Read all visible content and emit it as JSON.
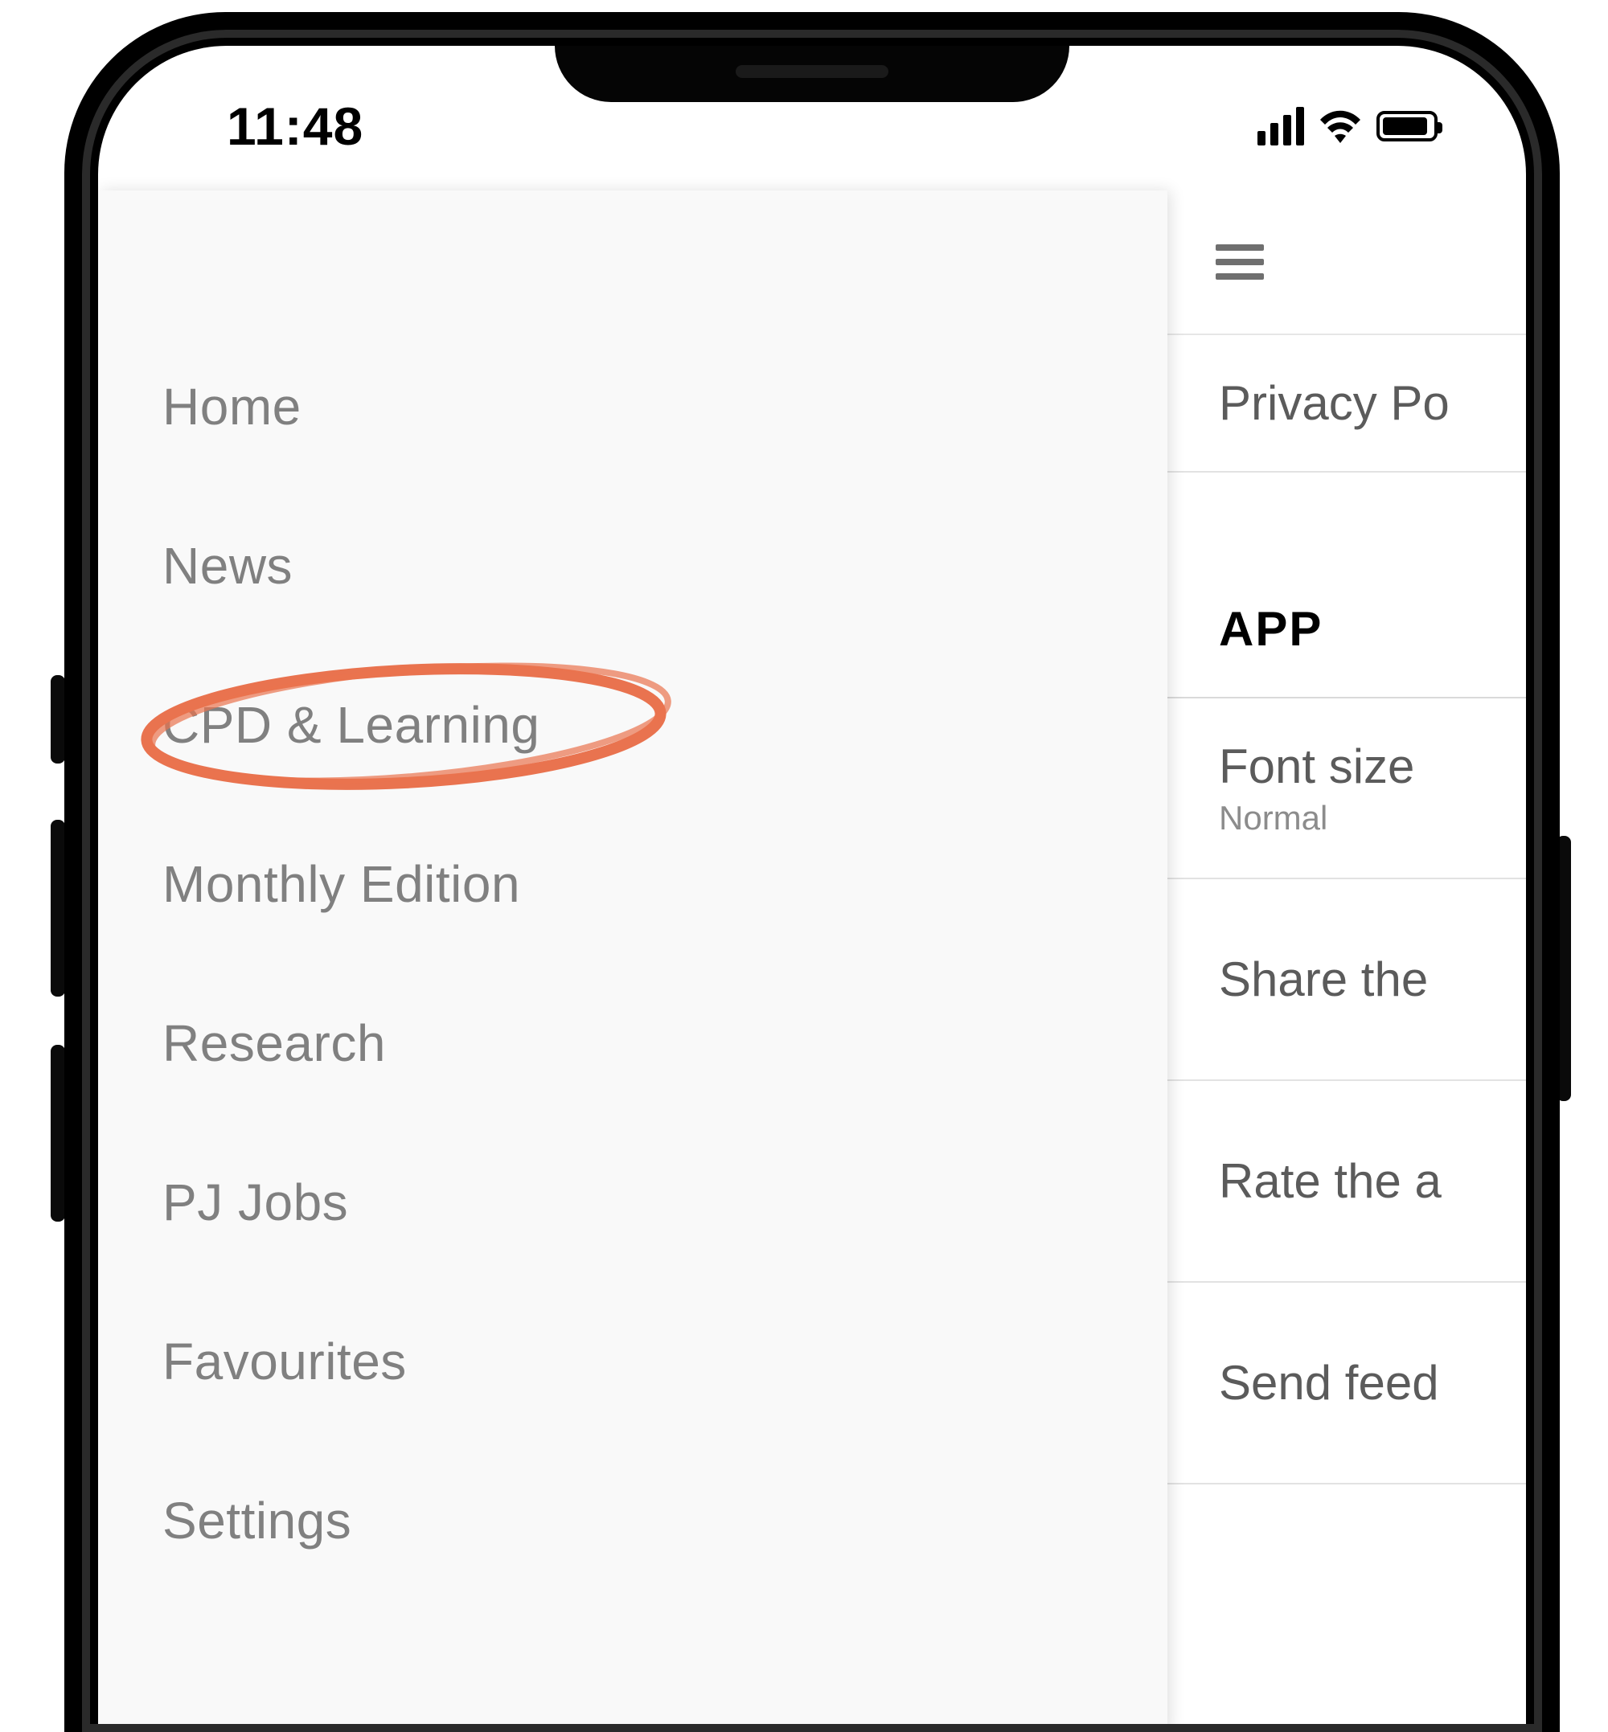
{
  "status": {
    "time": "11:48"
  },
  "drawer": {
    "items": [
      {
        "label": "Home"
      },
      {
        "label": "News"
      },
      {
        "label": "CPD & Learning"
      },
      {
        "label": "Monthly Edition"
      },
      {
        "label": "Research"
      },
      {
        "label": "PJ Jobs"
      },
      {
        "label": "Favourites"
      },
      {
        "label": "Settings"
      }
    ],
    "highlighted_index": 2
  },
  "settings": {
    "privacy_label": "Privacy Po",
    "section_app": "APP",
    "font_size_label": "Font size",
    "font_size_value": "Normal",
    "share_label": "Share the",
    "rate_label": "Rate the a",
    "send_label": "Send feed"
  }
}
